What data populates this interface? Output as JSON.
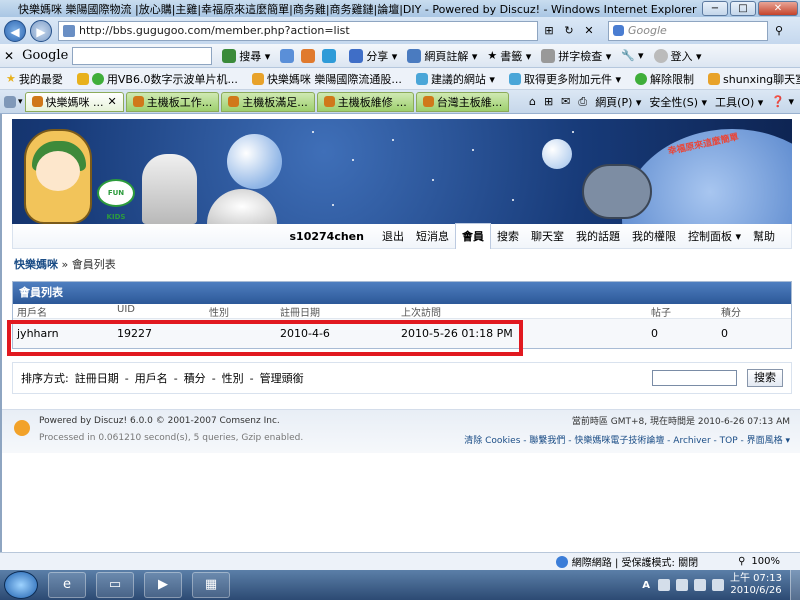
{
  "window": {
    "title": "快樂媽咪 樂陽國際物流 |放心購|主雞|幸福原來這麼簡單|商务雞|商务雞鏈|論壇|DIY - Powered by Discuz! - Windows Internet Explorer",
    "minimize_label": "−",
    "maximize_label": "□",
    "close_label": "✕"
  },
  "address": {
    "back_label": "◀",
    "forward_label": "▶",
    "url": "http://bbs.gugugoo.com/member.php?action=list",
    "search_placeholder": "Google"
  },
  "google_toolbar": {
    "close_label": "✕",
    "logo": "Google",
    "items": [
      "搜尋 ▾",
      "分享 ▾",
      "網頁註解 ▾",
      "書籤 ▾",
      "拼字檢查 ▾",
      "▾",
      "登入 ▾"
    ]
  },
  "favorites": {
    "items": [
      "我的最愛",
      "用VB6.0数字示波单片机...",
      "快樂媽咪 樂陽國際流通股...",
      "建議的網站 ▾",
      "取得更多附加元件 ▾",
      "解除限制",
      "shunxing聊天室"
    ]
  },
  "tabs": {
    "items": [
      {
        "label": "快樂媽咪 ...",
        "active": true
      },
      {
        "label": "主機板工作...",
        "active": false
      },
      {
        "label": "主機板滿足...",
        "active": false
      },
      {
        "label": "主機板維修 ...",
        "active": false
      },
      {
        "label": "台灣主板維...",
        "active": false
      }
    ],
    "commands": [
      "網頁(P) ▾",
      "安全性(S) ▾",
      "工具(O) ▾",
      "❓ ▾"
    ]
  },
  "banner": {
    "badge_text": "FUN KIDS",
    "slogan": "幸福原來這麼簡單"
  },
  "navbar": {
    "username": "s10274chen",
    "links": [
      "退出",
      "短消息",
      "會員",
      "搜索",
      "聊天室",
      "我的話題",
      "我的權限",
      "控制面板 ▾",
      "幫助"
    ],
    "active_index": 2
  },
  "breadcrumb": {
    "home": "快樂媽咪",
    "separator": "»",
    "current": "會員列表"
  },
  "member_table": {
    "title": "會員列表",
    "columns": [
      "用戶名",
      "UID",
      "性別",
      "註冊日期",
      "上次訪問",
      "帖子",
      "積分"
    ],
    "rows": [
      {
        "username": "jyhharn",
        "uid": "19227",
        "gender": "",
        "registered": "2010-4-6",
        "last_visit": "2010-5-26 01:18 PM",
        "posts": "0",
        "credits": "0"
      }
    ]
  },
  "sort": {
    "label": "排序方式:",
    "options": [
      "註冊日期",
      "用戶名",
      "積分",
      "性別",
      "管理頭銜"
    ],
    "separator": "-",
    "search_button": "搜索"
  },
  "footer": {
    "powered_by": "Powered by Discuz! 6.0.0 © 2001-2007 Comsenz Inc.",
    "processed": "Processed in 0.061210 second(s), 5 queries, Gzip enabled.",
    "time_info": "當前時區 GMT+8, 現在時間是 2010-6-26 07:13 AM",
    "links": "清除 Cookies - 聯繫我們 - 快樂媽咪電子技術論壇 - Archiver - TOP - 界面風格 ▾"
  },
  "status_bar": {
    "zone": "網際網路 | 受保護模式: 關閉",
    "zoom": "100%"
  },
  "taskbar": {
    "lang": "A",
    "time": "上午 07:13",
    "date": "2010/6/26"
  },
  "colors": {
    "highlight_box": "#e11920",
    "table_header": "#2c5898"
  }
}
